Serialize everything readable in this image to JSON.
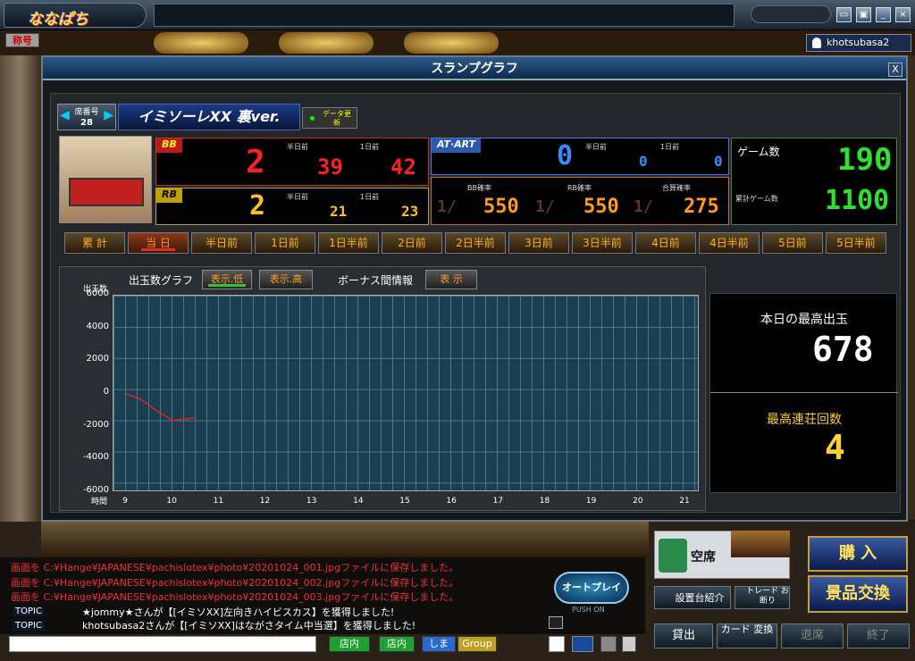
{
  "app": {
    "logo_text": "ななぱち",
    "tag_label": "称号",
    "username": "khotsubasa2"
  },
  "dialog": {
    "title": "スランプグラフ",
    "close": "X",
    "seat_label": "席番号",
    "seat_number": "28",
    "machine_name": "イミソーレXX 裏ver.",
    "data_button": "データ更新",
    "bb": {
      "label": "BB",
      "value": "2",
      "half_day_label": "半日前",
      "half_day": "39",
      "one_day_label": "1日前",
      "one_day": "42"
    },
    "rb": {
      "label": "RB",
      "value": "2",
      "half_day_label": "半日前",
      "half_day": "21",
      "one_day_label": "1日前",
      "one_day": "23"
    },
    "at": {
      "label": "AT·ART",
      "value": "0",
      "half_day_label": "半日前",
      "half_day": "0",
      "one_day_label": "1日前",
      "one_day": "0"
    },
    "rates": {
      "bb_label": "BB確率",
      "bb_value": "550",
      "rb_label": "RB確率",
      "rb_value": "550",
      "total_label": "合算確率",
      "total_value": "275",
      "prefix": "1/"
    },
    "games": {
      "label": "ゲーム数",
      "value": "190",
      "total_label": "累計ゲーム数",
      "total_value": "1100"
    },
    "tabs": [
      "累 計",
      "当 日",
      "半日前",
      "1日前",
      "1日半前",
      "2日前",
      "2日半前",
      "3日前",
      "3日半前",
      "4日前",
      "4日半前",
      "5日前",
      "5日半前"
    ],
    "active_tab": "当 日",
    "graph": {
      "tab_label": "出玉数グラフ",
      "btn_low": "表示.低",
      "btn_high": "表示.高",
      "bonus_label": "ボーナス間情報",
      "bonus_btn": "表 示",
      "ylabel": "出玉数",
      "xlabel": "時間"
    },
    "max_payout_label": "本日の最高出玉",
    "max_payout_value": "678",
    "max_streak_label": "最高連荘回数",
    "max_streak_value": "4"
  },
  "chart_data": {
    "type": "line",
    "title": "",
    "xlabel": "時間",
    "ylabel": "出玉数",
    "ylim": [
      -6000,
      6000
    ],
    "yticks": [
      "6000",
      "4000",
      "2000",
      "0",
      "-2000",
      "-4000",
      "-6000"
    ],
    "xlim": [
      9,
      21
    ],
    "xticks": [
      "9",
      "10",
      "11",
      "12",
      "13",
      "14",
      "15",
      "16",
      "17",
      "18",
      "19",
      "20",
      "21"
    ],
    "series": [
      {
        "points": [
          [
            9.0,
            0
          ],
          [
            9.3,
            -300
          ],
          [
            9.7,
            -1100
          ],
          [
            10.0,
            -1620
          ],
          [
            10.5,
            -1450
          ]
        ]
      }
    ],
    "color": "#e02020"
  },
  "bottom": {
    "logs": [
      "画面を C:¥Hange¥JAPANESE¥pachislotex¥photo¥20201024_001.jpgファイルに保存しました。",
      "画面を C:¥Hange¥JAPANESE¥pachislotex¥photo¥20201024_002.jpgファイルに保存しました。",
      "画面を C:¥Hange¥JAPANESE¥pachislotex¥photo¥20201024_003.jpgファイルに保存しました。"
    ],
    "topic_label": "TOPIC",
    "topics": [
      "★jommy★さんが【[イミソXX]左向きハイビスカス】を獲得しました!",
      "khotsubasa2さんが【[イミソXX]はながさタイム中当選】を獲得しました!"
    ],
    "autoplay": "オートプレイ",
    "push_on": "PUSH ON",
    "vacant": "空席",
    "intro_btn": "設置台紹介",
    "trade_btn": "トレード お断り",
    "buy_btn": "購 入",
    "exchange_btn": "景品交換",
    "lend_btn": "貸出",
    "card_btn": "カード 変換",
    "leave_btn": "退席",
    "end_btn": "終了",
    "chat_btns": [
      "店内",
      "店内",
      "しま",
      "Group"
    ]
  }
}
